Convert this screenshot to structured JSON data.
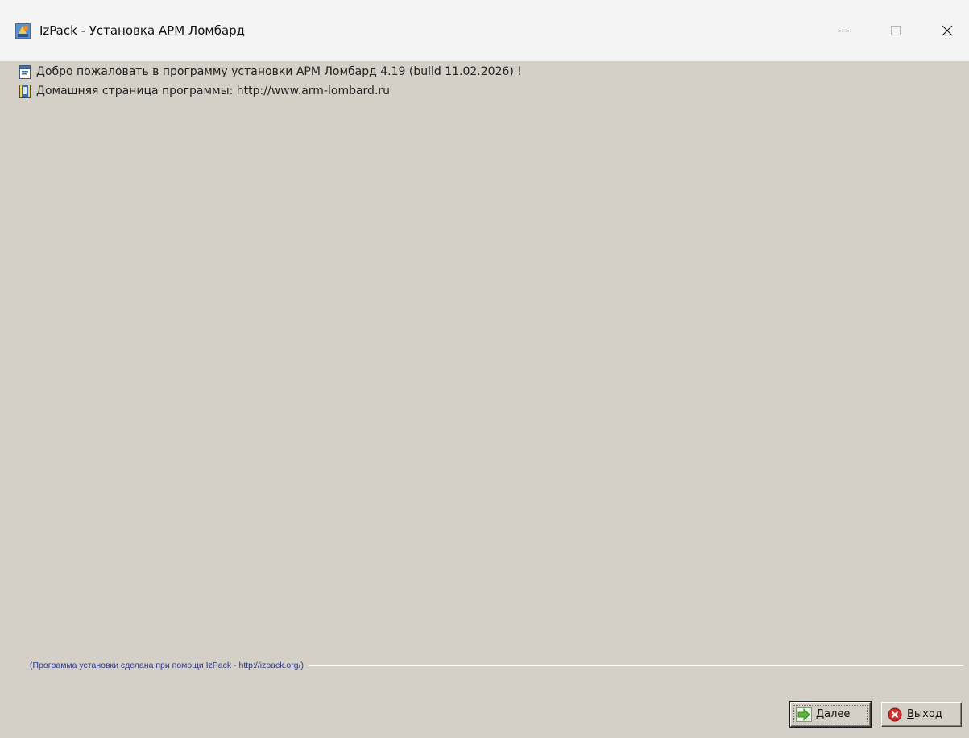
{
  "window": {
    "title": "IzPack - Установка  АРМ Ломбард",
    "app_icon": "izpack-app-icon",
    "controls": {
      "minimize_icon": "minimize-icon",
      "maximize_icon": "maximize-icon",
      "close_icon": "close-icon"
    }
  },
  "welcome": {
    "line1": {
      "icon": "info-panel-icon",
      "text": "Добро пожаловать в программу установки АРМ Ломбард 4.19 (build 11.02.2026) !"
    },
    "line2": {
      "icon": "book-icon",
      "text": "Домашняя страница программы: http://www.arm-lombard.ru"
    }
  },
  "footer": {
    "text": "(Программа установки сделана при помощи IzPack - http://izpack.org/)"
  },
  "buttons": {
    "next": {
      "mnemonic": "Д",
      "rest": "алее",
      "icon": "arrow-right-icon"
    },
    "exit": {
      "mnemonic": "В",
      "rest": "ыход",
      "icon": "exit-icon"
    }
  },
  "colors": {
    "window_bg": "#d4d0c8",
    "titlebar_bg": "#f4f4f4",
    "footer_text": "#2d3a8c",
    "exit_icon_red": "#d42b2b",
    "next_icon_green": "#5bb53a"
  }
}
